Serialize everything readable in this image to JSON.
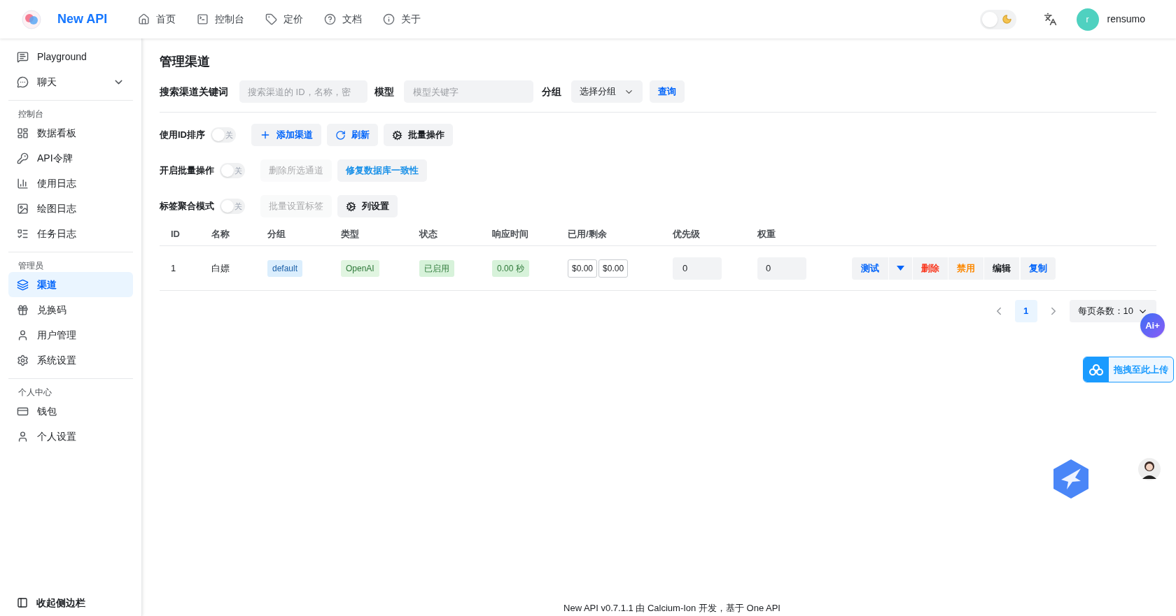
{
  "header": {
    "logo_text": "New API",
    "nav": [
      {
        "label": "首页"
      },
      {
        "label": "控制台"
      },
      {
        "label": "定价"
      },
      {
        "label": "文档"
      },
      {
        "label": "关于"
      }
    ],
    "dark_mode": {
      "on": false
    },
    "user": {
      "avatar_letter": "r",
      "name": "rensumo"
    }
  },
  "sidebar": {
    "top_items": [
      {
        "label": "Playground",
        "selected": false,
        "expandable": false
      },
      {
        "label": "聊天",
        "selected": false,
        "expandable": true
      }
    ],
    "sections": [
      {
        "title": "控制台",
        "items": [
          {
            "label": "数据看板",
            "selected": false
          },
          {
            "label": "API令牌",
            "selected": false
          },
          {
            "label": "使用日志",
            "selected": false
          },
          {
            "label": "绘图日志",
            "selected": false
          },
          {
            "label": "任务日志",
            "selected": false
          }
        ]
      },
      {
        "title": "管理员",
        "items": [
          {
            "label": "渠道",
            "selected": true
          },
          {
            "label": "兑换码",
            "selected": false
          },
          {
            "label": "用户管理",
            "selected": false
          },
          {
            "label": "系统设置",
            "selected": false
          }
        ]
      },
      {
        "title": "个人中心",
        "items": [
          {
            "label": "钱包",
            "selected": false
          },
          {
            "label": "个人设置",
            "selected": false
          }
        ]
      }
    ],
    "collapse_label": "收起侧边栏"
  },
  "page_title": "管理渠道",
  "search": {
    "keyword_label": "搜索渠道关键词",
    "keyword_placeholder": "搜索渠道的 ID，名称，密",
    "model_label": "模型",
    "model_placeholder": "模型关键字",
    "group_label": "分组",
    "group_select": "选择分组",
    "query_button": "查询"
  },
  "toolbar_rows": [
    {
      "label": "使用ID排序",
      "switch": {
        "on": false,
        "text": "关"
      },
      "buttons": [
        {
          "label": "添加渠道",
          "kind": "primary",
          "disabled": false
        },
        {
          "label": "刷新",
          "kind": "primary",
          "disabled": false
        },
        {
          "label": "批量操作",
          "kind": "default",
          "disabled": false
        }
      ]
    },
    {
      "label": "开启批量操作",
      "switch": {
        "on": false,
        "text": "关"
      },
      "buttons": [
        {
          "label": "删除所选通道",
          "kind": "default",
          "disabled": true
        },
        {
          "label": "修复数据库一致性",
          "kind": "info",
          "disabled": false
        }
      ]
    },
    {
      "label": "标签聚合模式",
      "switch": {
        "on": false,
        "text": "关"
      },
      "buttons": [
        {
          "label": "批量设置标签",
          "kind": "default",
          "disabled": true
        },
        {
          "label": "列设置",
          "kind": "default",
          "disabled": false
        }
      ]
    }
  ],
  "table": {
    "columns": [
      "ID",
      "名称",
      "分组",
      "类型",
      "状态",
      "响应时间",
      "已用/剩余",
      "优先级",
      "权重"
    ],
    "rows": [
      {
        "id": "1",
        "name": "白嫖",
        "group": {
          "text": "default",
          "color": "#dbeefd"
        },
        "type": {
          "text": "OpenAI",
          "color": "#e1f5e1"
        },
        "status": {
          "text": "已启用",
          "color": "#d7f2da"
        },
        "response_time": {
          "text": "0.00 秒",
          "color": "#d7f2da"
        },
        "used": "$0.00",
        "remaining": "$0.00",
        "priority": "0",
        "weight": "0",
        "actions": [
          {
            "label": "测试",
            "kind": "primary"
          },
          {
            "kind": "dropdown"
          },
          {
            "label": "删除",
            "kind": "danger"
          },
          {
            "label": "禁用",
            "kind": "warning"
          },
          {
            "label": "编辑",
            "kind": "default"
          },
          {
            "label": "复制",
            "kind": "primary"
          }
        ]
      }
    ]
  },
  "pagination": {
    "pages": [
      {
        "label": "1",
        "selected": true
      }
    ],
    "page_size": "每页条数：10"
  },
  "floating": {
    "ai_button": "Ai+",
    "upload_label": "拖拽至此上传"
  },
  "footer": "New API v0.7.1.1 由 Calcium-Ion 开发，基于 One API"
}
